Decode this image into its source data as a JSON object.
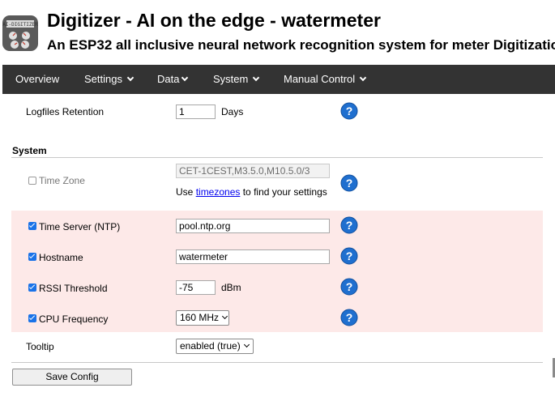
{
  "header": {
    "logo_text": "AI-DIGITIZER",
    "title": "Digitizer - AI on the edge - watermeter",
    "subtitle": "An ESP32 all inclusive neural network recognition system for meter Digitization"
  },
  "nav": {
    "overview": "Overview",
    "settings": "Settings",
    "data": "Data",
    "system": "System",
    "manual_control": "Manual Control"
  },
  "logfiles": {
    "label": "Logfiles Retention",
    "value": "1",
    "unit": "Days"
  },
  "section": {
    "system": "System"
  },
  "timezone": {
    "label": "Time Zone",
    "value": "CET-1CEST,M3.5.0,M10.5.0/3",
    "hint_prefix": "Use ",
    "hint_link": "timezones",
    "hint_suffix": " to find your settings",
    "enabled": false
  },
  "ntp": {
    "label": "Time Server (NTP)",
    "value": "pool.ntp.org",
    "enabled": true
  },
  "hostname": {
    "label": "Hostname",
    "value": "watermeter",
    "enabled": true
  },
  "rssi": {
    "label": "RSSI Threshold",
    "value": "-75",
    "unit": "dBm",
    "enabled": true
  },
  "cpu": {
    "label": "CPU Frequency",
    "value": "160 MHz",
    "enabled": true
  },
  "tooltip": {
    "label": "Tooltip",
    "value": "enabled (true)"
  },
  "save_label": "Save Config",
  "help_glyph": "?",
  "colors": {
    "navbar": "#333333",
    "highlight": "#fde9e8",
    "help": "#1f6fcf",
    "checkbox": "#1a73e8"
  }
}
